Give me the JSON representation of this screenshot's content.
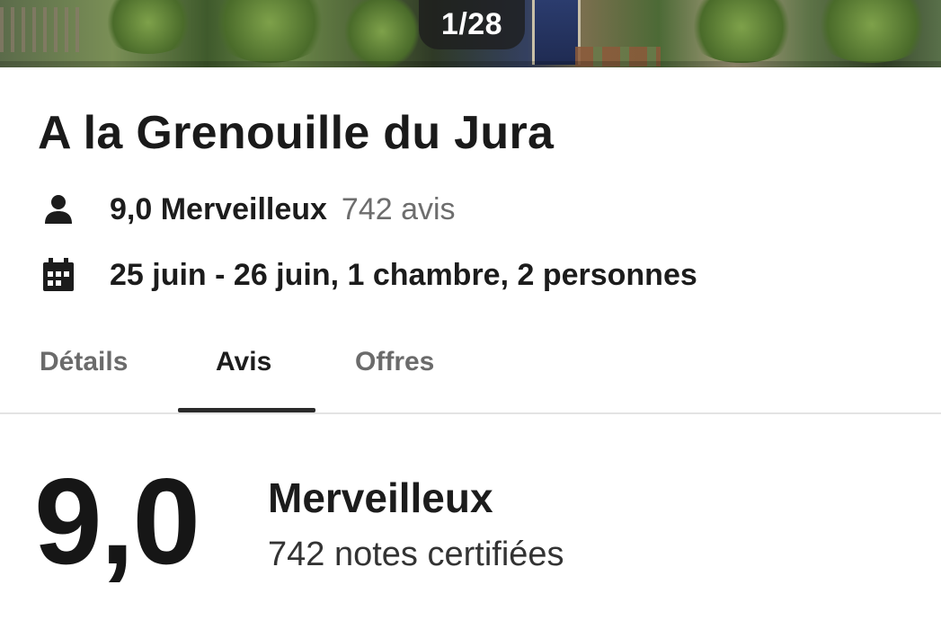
{
  "gallery": {
    "counter": "1/28"
  },
  "hotel": {
    "name": "A la Grenouille du Jura",
    "rating_line": "9,0 Merveilleux",
    "reviews_line": "742 avis",
    "dates_line": "25 juin - 26 juin, 1 chambre, 2 personnes",
    "rating_icon": "person-icon",
    "dates_icon": "calendar-icon"
  },
  "tabs": [
    {
      "label": "Détails",
      "active": false
    },
    {
      "label": "Avis",
      "active": true
    },
    {
      "label": "Offres",
      "active": false
    }
  ],
  "review_summary": {
    "score": "9,0",
    "label": "Merveilleux",
    "count": "742 notes certifiées"
  },
  "colors": {
    "text_primary": "#1c1c1c",
    "text_secondary": "#6d6d6d",
    "tab_inactive": "#6b6b6b",
    "underline": "#2a2a2a"
  }
}
